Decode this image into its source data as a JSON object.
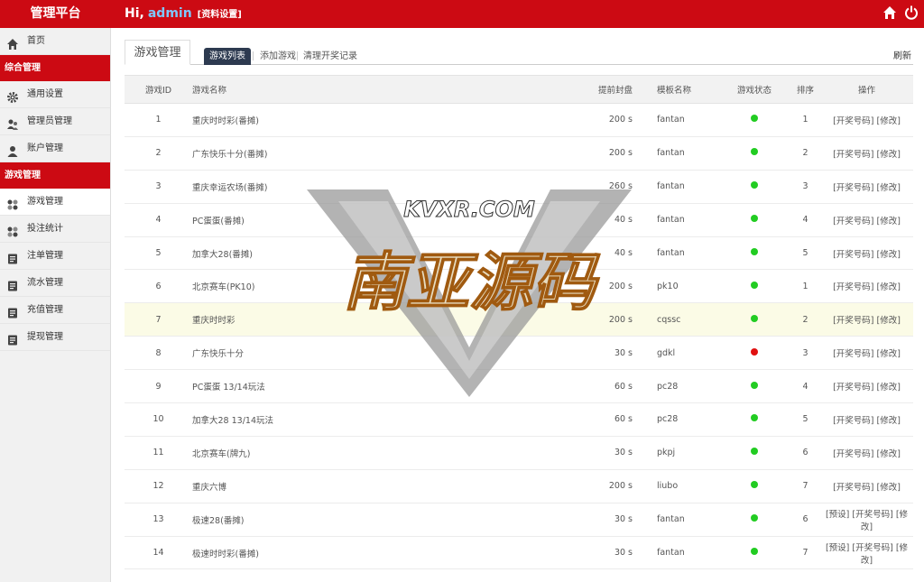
{
  "header": {
    "brand": "管理平台",
    "greeting": "Hi,",
    "username": "admin",
    "profile_link": "[资料设置]"
  },
  "sidebar": {
    "home": "首页",
    "group1": "综合管理",
    "items1": [
      {
        "label": "通用设置",
        "icon": "gear-icon"
      },
      {
        "label": "管理员管理",
        "icon": "users-icon"
      },
      {
        "label": "账户管理",
        "icon": "user-icon"
      }
    ],
    "group2": "游戏管理",
    "items2": [
      {
        "label": "游戏管理",
        "icon": "game-icon"
      },
      {
        "label": "投注统计",
        "icon": "stats-icon"
      },
      {
        "label": "注单管理",
        "icon": "list-icon"
      },
      {
        "label": "流水管理",
        "icon": "list-icon"
      },
      {
        "label": "充值管理",
        "icon": "list-icon"
      },
      {
        "label": "提现管理",
        "icon": "list-icon"
      }
    ]
  },
  "main": {
    "page_tab": "游戏管理",
    "subtab_active": "游戏列表",
    "subtab_add": "添加游戏",
    "subtab_clear": "清理开奖记录",
    "refresh": "刷新"
  },
  "table": {
    "headers": [
      "游戏ID",
      "游戏名称",
      "提前封盘",
      "模板名称",
      "游戏状态",
      "排序",
      "操作"
    ],
    "rows": [
      {
        "id": "1",
        "name": "重庆时时彩(番摊)",
        "sec": "200 s",
        "tpl": "fantan",
        "status": "on",
        "sort": "1",
        "ops": "[开奖号码] [修改]"
      },
      {
        "id": "2",
        "name": "广东快乐十分(番摊)",
        "sec": "200 s",
        "tpl": "fantan",
        "status": "on",
        "sort": "2",
        "ops": "[开奖号码] [修改]"
      },
      {
        "id": "3",
        "name": "重庆幸运农场(番摊)",
        "sec": "260 s",
        "tpl": "fantan",
        "status": "on",
        "sort": "3",
        "ops": "[开奖号码] [修改]"
      },
      {
        "id": "4",
        "name": "PC蛋蛋(番摊)",
        "sec": "40 s",
        "tpl": "fantan",
        "status": "on",
        "sort": "4",
        "ops": "[开奖号码] [修改]"
      },
      {
        "id": "5",
        "name": "加拿大28(番摊)",
        "sec": "40 s",
        "tpl": "fantan",
        "status": "on",
        "sort": "5",
        "ops": "[开奖号码] [修改]"
      },
      {
        "id": "6",
        "name": "北京赛车(PK10)",
        "sec": "200 s",
        "tpl": "pk10",
        "status": "on",
        "sort": "1",
        "ops": "[开奖号码] [修改]"
      },
      {
        "id": "7",
        "name": "重庆时时彩",
        "sec": "200 s",
        "tpl": "cqssc",
        "status": "on",
        "sort": "2",
        "ops": "[开奖号码] [修改]"
      },
      {
        "id": "8",
        "name": "广东快乐十分",
        "sec": "30 s",
        "tpl": "gdkl",
        "status": "off",
        "sort": "3",
        "ops": "[开奖号码] [修改]"
      },
      {
        "id": "9",
        "name": "PC蛋蛋 13/14玩法",
        "sec": "60 s",
        "tpl": "pc28",
        "status": "on",
        "sort": "4",
        "ops": "[开奖号码] [修改]"
      },
      {
        "id": "10",
        "name": "加拿大28 13/14玩法",
        "sec": "60 s",
        "tpl": "pc28",
        "status": "on",
        "sort": "5",
        "ops": "[开奖号码] [修改]"
      },
      {
        "id": "11",
        "name": "北京赛车(牌九)",
        "sec": "30 s",
        "tpl": "pkpj",
        "status": "on",
        "sort": "6",
        "ops": "[开奖号码] [修改]"
      },
      {
        "id": "12",
        "name": "重庆六博",
        "sec": "200 s",
        "tpl": "liubo",
        "status": "on",
        "sort": "7",
        "ops": "[开奖号码] [修改]"
      },
      {
        "id": "13",
        "name": "极速28(番摊)",
        "sec": "30 s",
        "tpl": "fantan",
        "status": "on",
        "sort": "6",
        "ops": "[预设] [开奖号码] [修改]"
      },
      {
        "id": "14",
        "name": "极速时时彩(番摊)",
        "sec": "30 s",
        "tpl": "fantan",
        "status": "on",
        "sort": "7",
        "ops": "[预设] [开奖号码] [修改]"
      }
    ]
  },
  "colors": {
    "brand_red": "#cc0a13",
    "status_on": "#22cc22",
    "status_off": "#e01010",
    "highlight_row": "#fbfbe6"
  },
  "watermark": {
    "url_text": "KVXR.COM",
    "name_text": "南亚源码"
  }
}
